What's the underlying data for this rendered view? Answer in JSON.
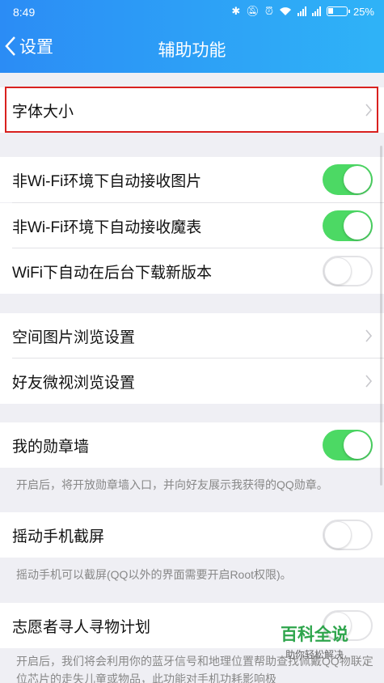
{
  "status": {
    "time": "8:49",
    "battery": "25%"
  },
  "nav": {
    "back": "设置",
    "title": "辅助功能"
  },
  "rows": {
    "font_size": "字体大小",
    "nonwifi_images": "非Wi-Fi环境下自动接收图片",
    "nonwifi_emoji": "非Wi-Fi环境下自动接收魔表",
    "wifi_download": "WiFi下自动在后台下载新版本",
    "space_browse": "空间图片浏览设置",
    "friend_video": "好友微视浏览设置",
    "medal_wall": "我的勋章墙",
    "medal_note": "开启后，将开放勋章墙入口，并向好友展示我获得的QQ勋章。",
    "shake_screenshot": "摇动手机截屏",
    "shake_note": "摇动手机可以截屏(QQ以外的界面需要开启Root权限)。",
    "volunteer": "志愿者寻人寻物计划",
    "volunteer_note": "开启后，我们将会利用你的蓝牙信号和地理位置帮助查找佩戴QQ物联定位芯片的走失儿童或物品，此功能对手机功耗影响极"
  },
  "toggles": {
    "nonwifi_images": true,
    "nonwifi_emoji": true,
    "wifi_download": false,
    "medal_wall": true,
    "shake_screenshot": false,
    "volunteer": false
  },
  "colors": {
    "accent": "#2b8cf5",
    "toggle_on": "#4cd964",
    "highlight": "#d9211f"
  },
  "watermark": {
    "title": "百科全说",
    "subtitle": "助你轻松解决"
  }
}
